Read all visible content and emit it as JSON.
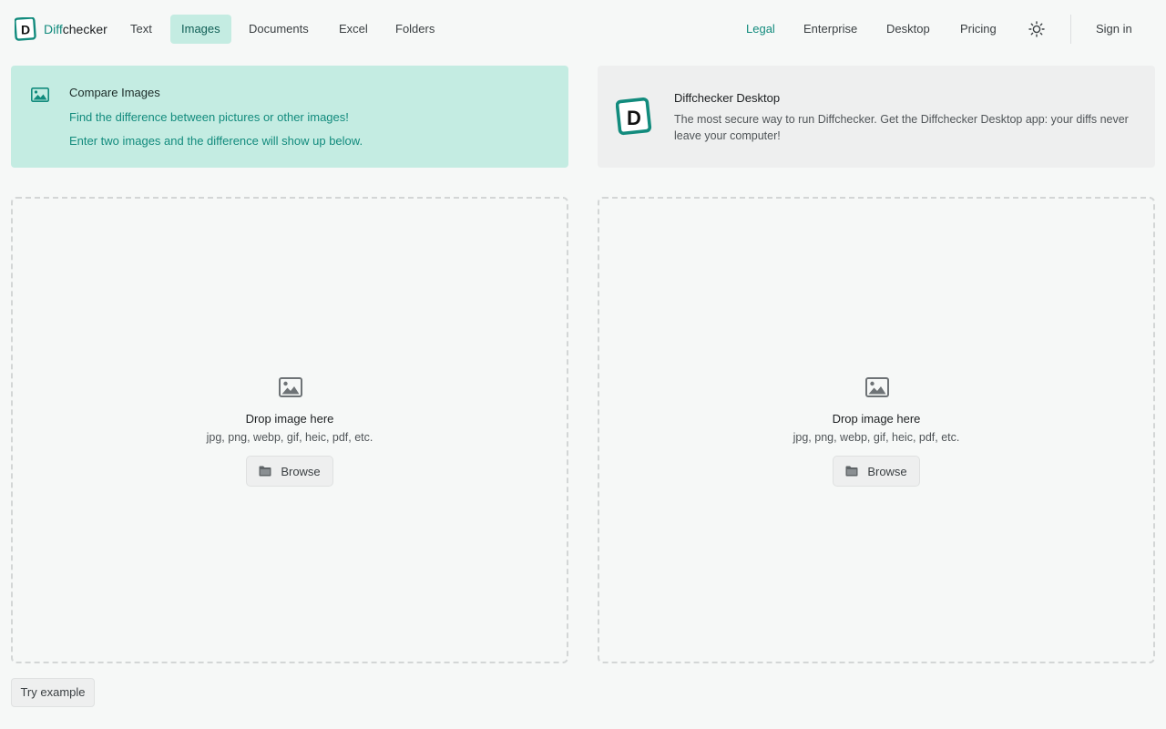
{
  "brand": {
    "name_accent": "Diff",
    "name_rest": "checker",
    "logo_icon": "diffchecker-logo-icon",
    "accent_color": "#128b7d"
  },
  "nav": {
    "text": "Text",
    "images": "Images",
    "documents": "Documents",
    "excel": "Excel",
    "folders": "Folders",
    "legal": "Legal",
    "enterprise": "Enterprise",
    "desktop": "Desktop",
    "pricing": "Pricing",
    "theme_icon": "sun-icon",
    "sign_in": "Sign in",
    "active": "Images"
  },
  "compare_banner": {
    "icon": "image-icon",
    "title": "Compare Images",
    "line1": "Find the difference between pictures or other images!",
    "line2": "Enter two images and the difference will show up below.",
    "bg_color": "#c4ece2"
  },
  "desktop_banner": {
    "icon": "diffchecker-desktop-logo-icon",
    "title": "Diffchecker Desktop",
    "description": "The most secure way to run Diffchecker. Get the Diffchecker Desktop app: your diffs never leave your computer!"
  },
  "dropzones": [
    {
      "icon": "image-icon",
      "title": "Drop image here",
      "formats": "jpg, png, webp, gif, heic, pdf, etc.",
      "browse_icon": "folder-icon",
      "browse_label": "Browse"
    },
    {
      "icon": "image-icon",
      "title": "Drop image here",
      "formats": "jpg, png, webp, gif, heic, pdf, etc.",
      "browse_icon": "folder-icon",
      "browse_label": "Browse"
    }
  ],
  "try_example": "Try example"
}
